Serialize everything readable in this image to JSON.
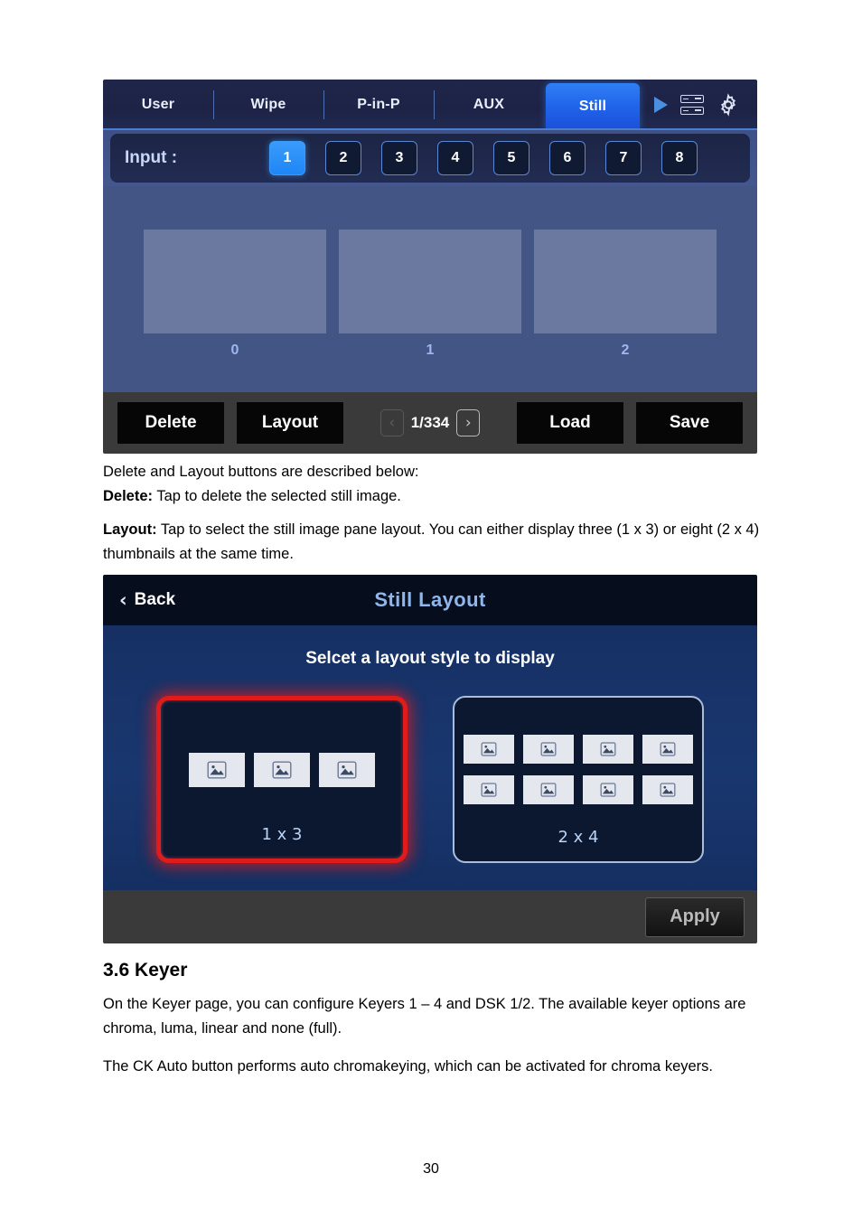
{
  "document": {
    "page_number": "30",
    "section_heading": "3.6 Keyer",
    "paragraphs": {
      "intro_line": "Delete and Layout buttons are described below:",
      "delete_label": "Delete:",
      "delete_desc": " Tap to delete the selected still image.",
      "layout_label": "Layout:",
      "layout_desc": " Tap to select the still image pane layout. You can either display three (1 x 3) or eight (2 x 4) thumbnails at the same time.",
      "keyer_p1": "On the Keyer page, you can configure Keyers 1 – 4 and DSK 1/2. The available keyer options are chroma, luma, linear and none (full).",
      "keyer_p2": "The CK Auto button performs auto chromakeying, which can be activated for chroma keyers."
    }
  },
  "still_panel": {
    "tabs": [
      {
        "label": "User",
        "active": false
      },
      {
        "label": "Wipe",
        "active": false
      },
      {
        "label": "P-in-P",
        "active": false
      },
      {
        "label": "AUX",
        "active": false
      },
      {
        "label": "Still",
        "active": true
      }
    ],
    "header_icons": [
      {
        "name": "play-icon"
      },
      {
        "name": "server-rack-icon"
      },
      {
        "name": "gear-icon"
      }
    ],
    "input_row": {
      "label": "Input :",
      "buttons": [
        "1",
        "2",
        "3",
        "4",
        "5",
        "6",
        "7",
        "8"
      ],
      "selected": "1"
    },
    "thumbnails": [
      {
        "caption": "0"
      },
      {
        "caption": "1"
      },
      {
        "caption": "2"
      }
    ],
    "footer": {
      "delete_label": "Delete",
      "layout_label": "Layout",
      "prev_arrow": "‹",
      "page_indicator": "1/334",
      "next_arrow": "›",
      "load_label": "Load",
      "save_label": "Save"
    }
  },
  "layout_panel": {
    "back_label": "Back",
    "back_chevron": "‹",
    "title": "Still Layout",
    "subtitle": "Selcet a layout style to display",
    "cards": [
      {
        "label": "1 x 3",
        "selected": true,
        "rows": 1,
        "cols": 3
      },
      {
        "label": "2 x 4",
        "selected": false,
        "rows": 2,
        "cols": 4
      }
    ],
    "apply_label": "Apply"
  },
  "colors": {
    "accent_blue": "#2f7ff4",
    "selected_red": "#e01b1b",
    "panel_body_blue": "#425584",
    "layout_body_blue": "#19376f",
    "footer_grey": "#3a3a3a",
    "title_blue": "#8fb7ee"
  }
}
